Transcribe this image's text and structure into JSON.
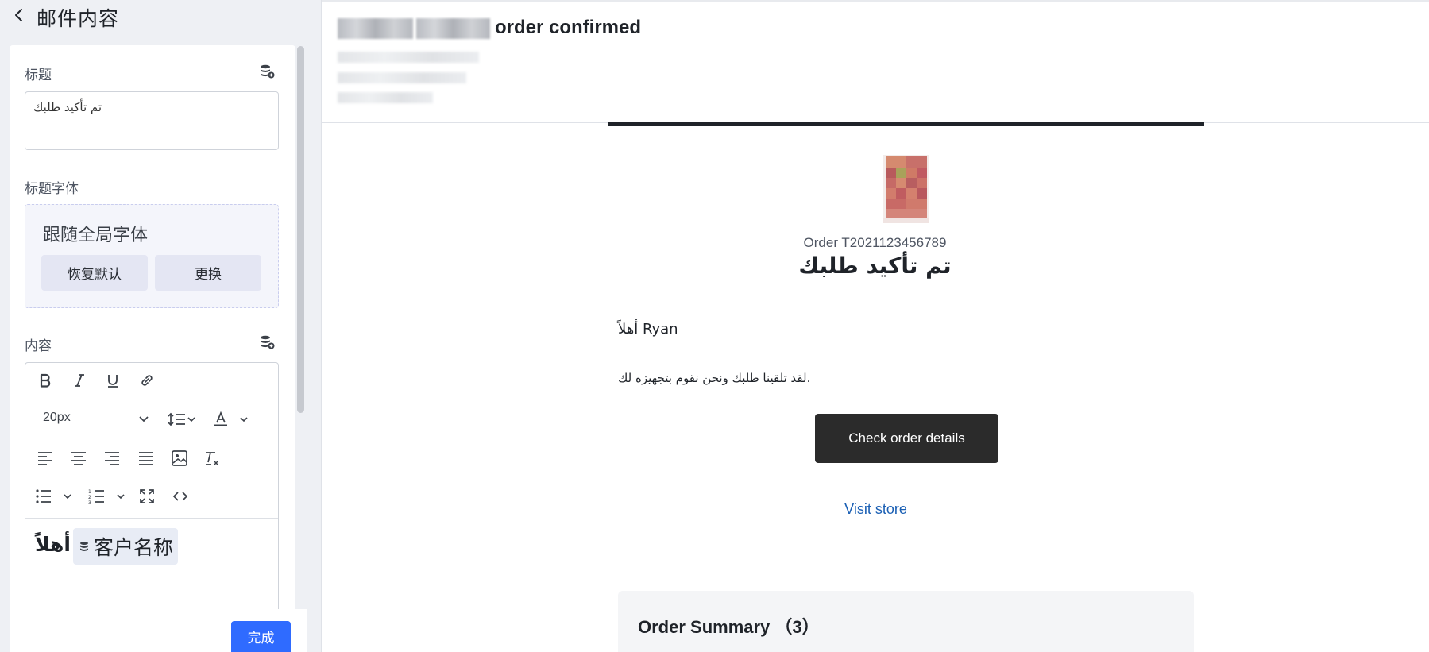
{
  "left_panel": {
    "title": "邮件内容",
    "title_section": {
      "label": "标题",
      "value": "تم تأكيد طلبك"
    },
    "title_font_section": {
      "label": "标题字体",
      "current_font": "跟随全局字体",
      "reset_label": "恢复默认",
      "change_label": "更换"
    },
    "content_section": {
      "label": "内容",
      "font_size": "20px",
      "content_text": "أهلاً",
      "variable_chip": "客户名称"
    },
    "done_label": "完成"
  },
  "email_preview": {
    "subject_suffix": "order confirmed",
    "order_number": "Order T2021123456789",
    "order_title": "تم تأكيد طلبك",
    "greeting": "أهلاً Ryan",
    "message": "لقد تلقينا طلبك ونحن نقوم بتجهيزه لك.",
    "check_button": "Check order details",
    "visit_link": "Visit store",
    "summary_title": "Order Summary （3）"
  },
  "colors": {
    "primary": "#2f6bff",
    "dark_button": "#2b2b2b",
    "link": "#1a5fb4",
    "panel_bg": "#eef0f4"
  }
}
